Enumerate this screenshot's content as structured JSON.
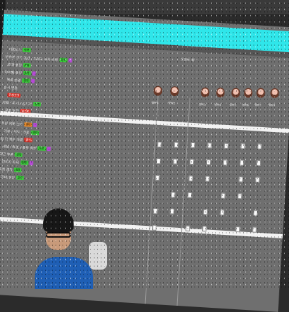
{
  "window": {
    "subtitle": "오늘도 끝"
  },
  "list": {
    "rows": [
      {
        "label": "이름보기",
        "tag": "설정",
        "tag_color": "green",
        "chip": false
      },
      {
        "label": "방송에 보기 옵션 / 드래그 위치 조정",
        "tag": "설정",
        "tag_color": "green",
        "chip": true
      },
      {
        "label": "효과 설정",
        "tag": "적용",
        "tag_color": "green",
        "chip": false
      },
      {
        "label": "아이템 설정",
        "tag": "설정",
        "tag_color": "green",
        "chip": true
      },
      {
        "label": "목록 변경",
        "tag": "설정",
        "tag_color": "green",
        "chip": true
      },
      {
        "label": "순서 변경",
        "tag": "",
        "tag_color": "green",
        "chip": false
      },
      {
        "label": "",
        "tag": "전체선택",
        "tag_color": "red",
        "chip": false
      },
      {
        "label": "알림 / 표시 / 숨기기",
        "tag": "설정",
        "tag_color": "green",
        "chip": false
      },
      {
        "label": "목표 설정",
        "tag": "초기화",
        "tag_color": "red",
        "chip": false
      },
      {
        "label": "후원 목록 보기",
        "tag": "설정",
        "tag_color": "orange",
        "chip": true
      },
      {
        "label": "기본 / 위치 / 후원",
        "tag": "설정",
        "tag_color": "green",
        "chip": false
      },
      {
        "label": "팀 간 점수 대결",
        "tag": "표시",
        "tag_color": "red",
        "chip": false
      },
      {
        "label": "게임 / 투표 / 룰렛 설정",
        "tag": "설정",
        "tag_color": "green",
        "chip": true
      },
      {
        "label": "최근 후원",
        "tag": "설정",
        "tag_color": "green",
        "chip": false
      },
      {
        "label": "참여자 목록",
        "tag": "설정",
        "tag_color": "green",
        "chip": true
      },
      {
        "label": "룰렛 결과",
        "tag": "설정",
        "tag_color": "green",
        "chip": false
      },
      {
        "label": "기타 설정",
        "tag": "설정",
        "tag_color": "green",
        "chip": false
      }
    ]
  },
  "members": [
    "멤버1",
    "멤버2",
    "멤버3",
    "멤버4",
    "멤버5",
    "멤버6",
    "멤버7",
    "멤버8"
  ]
}
